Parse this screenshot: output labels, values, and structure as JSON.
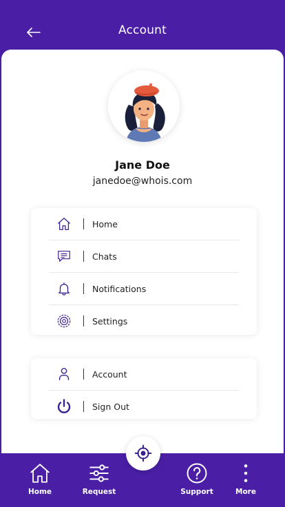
{
  "header": {
    "title": "Account"
  },
  "profile": {
    "name": "Jane Doe",
    "email": "janedoe@whois.com"
  },
  "menu_primary": [
    {
      "label": "Home",
      "icon": "home-icon"
    },
    {
      "label": "Chats",
      "icon": "chat-icon"
    },
    {
      "label": "Notifications",
      "icon": "bell-icon"
    },
    {
      "label": "Settings",
      "icon": "settings-icon"
    }
  ],
  "menu_secondary": [
    {
      "label": "Account",
      "icon": "user-icon"
    },
    {
      "label": "Sign Out",
      "icon": "power-icon"
    }
  ],
  "bottom_nav": [
    {
      "label": "Home",
      "icon": "home-icon"
    },
    {
      "label": "Request",
      "icon": "sliders-icon"
    },
    {
      "label": "Support",
      "icon": "help-icon"
    },
    {
      "label": "More",
      "icon": "more-vertical-icon"
    }
  ],
  "fab": {
    "icon": "location-target-icon"
  },
  "colors": {
    "brand": "#4a1fa6",
    "icon_stroke": "#3a1f8f",
    "background": "#ffffff"
  }
}
